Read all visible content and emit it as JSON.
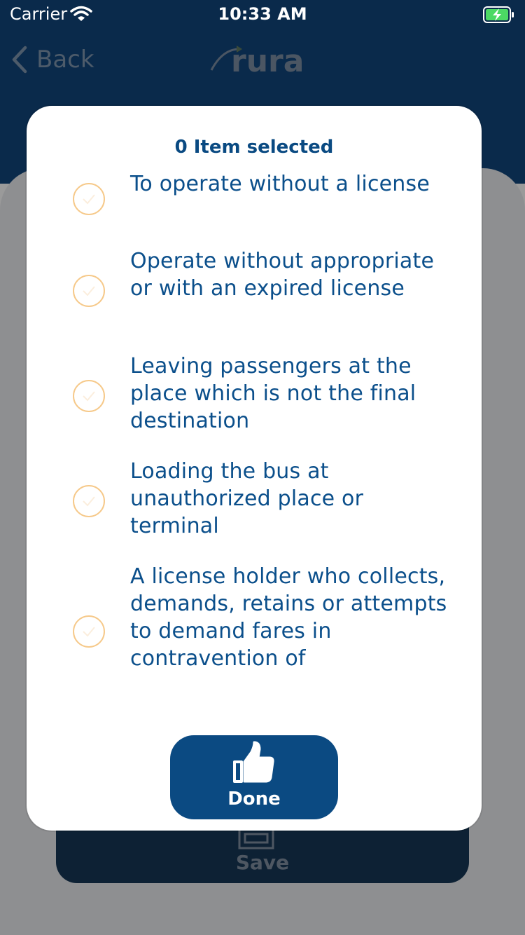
{
  "status_bar": {
    "carrier": "Carrier",
    "time": "10:33 AM"
  },
  "nav": {
    "back_label": "Back",
    "logo_text": "rura"
  },
  "modal": {
    "title": "0 Item selected",
    "options": [
      {
        "label": "To operate without a license",
        "selected": false
      },
      {
        "label": "Operate without appropriate or with an expired license",
        "selected": false
      },
      {
        "label": "Leaving passengers at the place which is not the final destination",
        "selected": false
      },
      {
        "label": "Loading the bus at unauthorized place or terminal",
        "selected": false
      },
      {
        "label": "A license holder who collects, demands, retains or attempts to demand fares in contravention of",
        "selected": false
      }
    ],
    "done_label": "Done"
  },
  "background": {
    "save_label": "Save"
  },
  "colors": {
    "primary": "#0b4a82",
    "radio_border": "#f6c98a",
    "nav_bg": "#0a2a4b"
  },
  "icons": {
    "back": "chevron-left-icon",
    "done": "thumbs-up-icon",
    "save": "save-icon",
    "wifi": "wifi-icon",
    "battery": "battery-charging-icon"
  }
}
